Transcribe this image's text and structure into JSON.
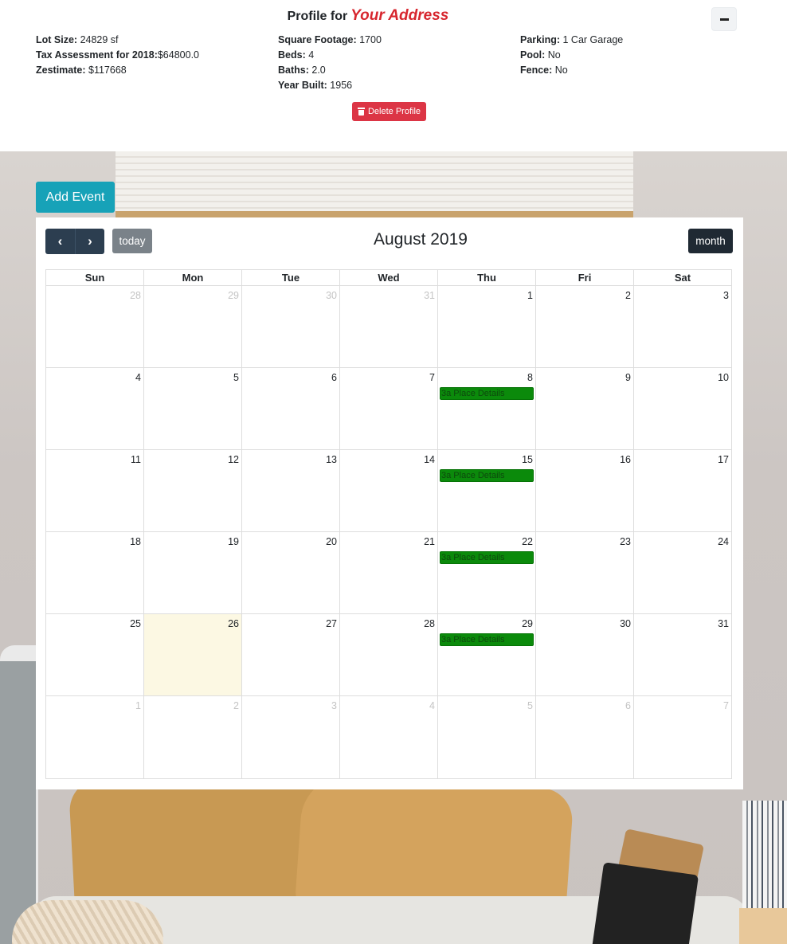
{
  "profile": {
    "title_prefix": "Profile for",
    "address": "Your Address",
    "collapse_label": "−",
    "col1": [
      {
        "label": "Lot Size:",
        "value": " 24829 sf"
      },
      {
        "label": "Tax Assessment for 2018:",
        "value": "$64800.0"
      },
      {
        "label": "Zestimate:",
        "value": " $117668"
      }
    ],
    "col2": [
      {
        "label": "Square Footage:",
        "value": " 1700"
      },
      {
        "label": "Beds:",
        "value": " 4"
      },
      {
        "label": "Baths:",
        "value": " 2.0"
      },
      {
        "label": "Year Built:",
        "value": " 1956"
      }
    ],
    "col3": [
      {
        "label": "Parking:",
        "value": " 1 Car Garage"
      },
      {
        "label": "Pool:",
        "value": " No"
      },
      {
        "label": "Fence:",
        "value": " No"
      }
    ],
    "delete_label": "Delete Profile"
  },
  "add_event_label": "Add Event",
  "calendar": {
    "prev_icon": "‹",
    "next_icon": "›",
    "today_label": "today",
    "title": "August 2019",
    "month_label": "month",
    "days_of_week": [
      "Sun",
      "Mon",
      "Tue",
      "Wed",
      "Thu",
      "Fri",
      "Sat"
    ],
    "weeks": [
      [
        {
          "n": "28",
          "other": true
        },
        {
          "n": "29",
          "other": true
        },
        {
          "n": "30",
          "other": true
        },
        {
          "n": "31",
          "other": true
        },
        {
          "n": "1"
        },
        {
          "n": "2"
        },
        {
          "n": "3"
        }
      ],
      [
        {
          "n": "4"
        },
        {
          "n": "5"
        },
        {
          "n": "6"
        },
        {
          "n": "7"
        },
        {
          "n": "8",
          "event": "3a Place Details"
        },
        {
          "n": "9"
        },
        {
          "n": "10"
        }
      ],
      [
        {
          "n": "11"
        },
        {
          "n": "12"
        },
        {
          "n": "13"
        },
        {
          "n": "14"
        },
        {
          "n": "15",
          "event": "3a Place Details"
        },
        {
          "n": "16"
        },
        {
          "n": "17"
        }
      ],
      [
        {
          "n": "18"
        },
        {
          "n": "19"
        },
        {
          "n": "20"
        },
        {
          "n": "21"
        },
        {
          "n": "22",
          "event": "3a Place Details"
        },
        {
          "n": "23"
        },
        {
          "n": "24"
        }
      ],
      [
        {
          "n": "25"
        },
        {
          "n": "26",
          "today": true
        },
        {
          "n": "27"
        },
        {
          "n": "28"
        },
        {
          "n": "29",
          "event": "3a Place Details"
        },
        {
          "n": "30"
        },
        {
          "n": "31"
        }
      ],
      [
        {
          "n": "1",
          "other": true
        },
        {
          "n": "2",
          "other": true
        },
        {
          "n": "3",
          "other": true
        },
        {
          "n": "4",
          "other": true
        },
        {
          "n": "5",
          "other": true
        },
        {
          "n": "6",
          "other": true
        },
        {
          "n": "7",
          "other": true
        }
      ]
    ],
    "event_color": "#0b8a0b",
    "today_color": "#fcf8e3"
  }
}
